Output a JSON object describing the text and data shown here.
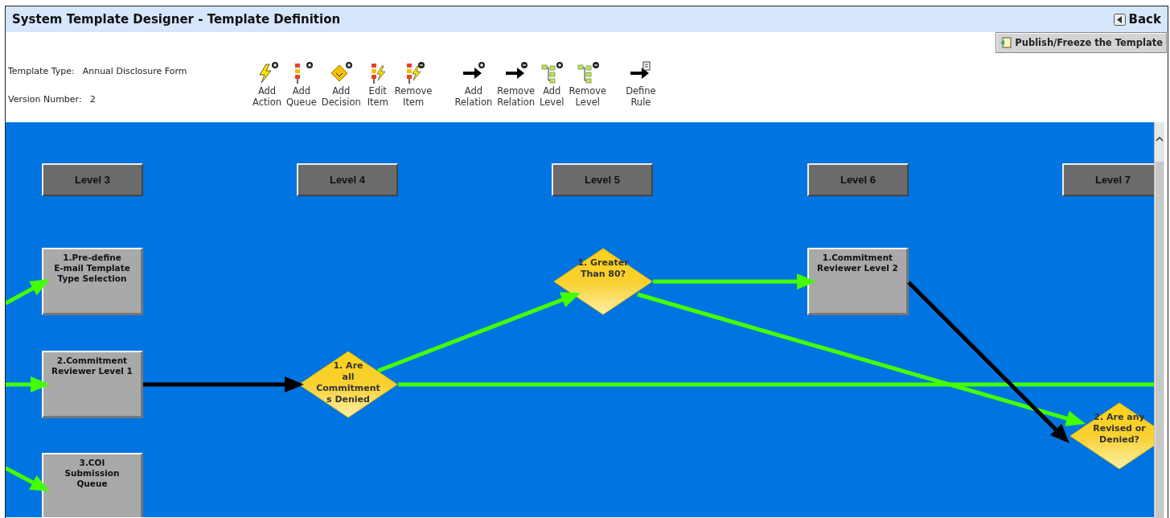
{
  "window": {
    "title": "System Template Designer - Template Definition"
  },
  "back_button": {
    "label": "Back"
  },
  "publish_button": {
    "label": "Publish/Freeze the Template"
  },
  "template_info": [
    {
      "label": "Template Type:",
      "value": "Annual Disclosure Form"
    },
    {
      "label": "Version Number:",
      "value": "2"
    }
  ],
  "toolbar": [
    {
      "kind": "action",
      "label": "Add Action"
    },
    {
      "kind": "queue",
      "label": "Add Queue"
    },
    {
      "kind": "decision",
      "label": "Add Decision"
    },
    {
      "kind": "edit",
      "label": "Edit Item"
    },
    {
      "kind": "remove-item",
      "label": "Remove Item"
    },
    {
      "kind": "add-relation",
      "label": "Add Relation"
    },
    {
      "kind": "remove-relation",
      "label": "Remove Relation"
    },
    {
      "kind": "add-level",
      "label": "Add Level"
    },
    {
      "kind": "remove-level",
      "label": "Remove Level"
    },
    {
      "kind": "rule",
      "label": "Define Rule"
    }
  ],
  "canvas": {
    "levels": [
      "Level 3",
      "Level 4",
      "Level 5",
      "Level 6",
      "Level 7"
    ],
    "nodes": [
      {
        "kind": "queue",
        "label": "1.Pre-define\nE-mail Template\nType Selection"
      },
      {
        "kind": "queue",
        "label": "2.Commitment\nReviewer Level 1"
      },
      {
        "kind": "queue",
        "label": "3.COI\nSubmission\nQueue"
      },
      {
        "kind": "decision",
        "label": "1. Are\nall\nCommitment\ns Denied"
      },
      {
        "kind": "decision",
        "label": "1. Greater\nThan 80?"
      },
      {
        "kind": "queue",
        "label": "1.Commitment\nReviewer Level 2"
      },
      {
        "kind": "decision",
        "label": "2. Are any\nRevised or\nDenied?"
      }
    ],
    "relations": [
      {
        "color": "#44ff00"
      },
      {
        "color": "#44ff00"
      },
      {
        "color": "#44ff00"
      },
      {
        "color": "#000000"
      },
      {
        "color": "#44ff00"
      },
      {
        "color": "#44ff00"
      },
      {
        "color": "#44ff00"
      },
      {
        "color": "#44ff00"
      },
      {
        "color": "#000000"
      }
    ]
  }
}
